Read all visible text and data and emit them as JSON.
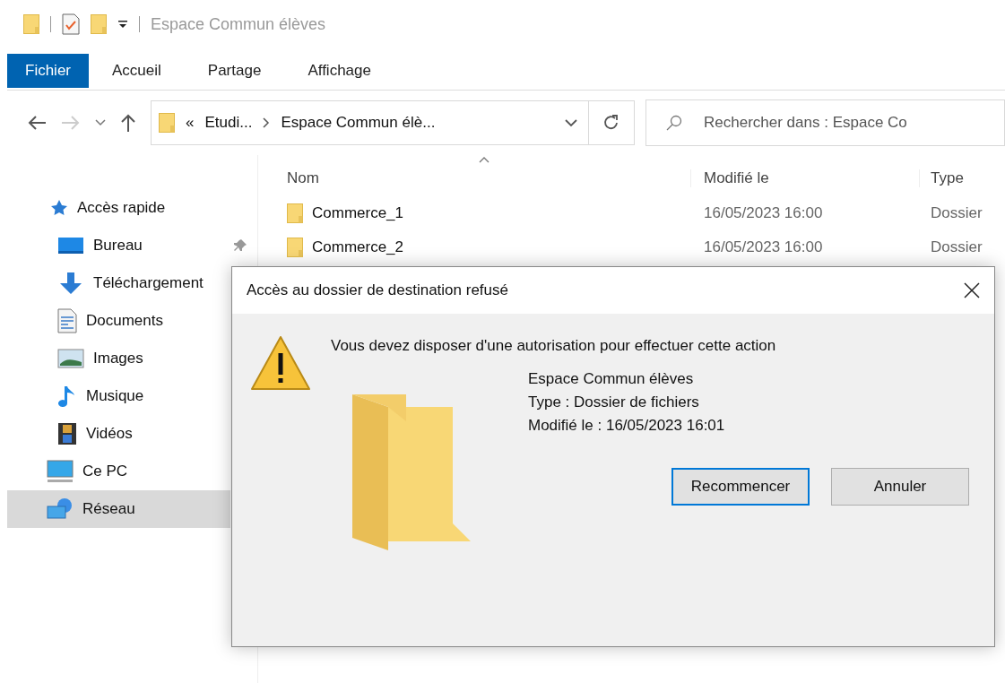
{
  "window": {
    "title": "Espace Commun élèves"
  },
  "ribbon_tabs": [
    {
      "label": "Fichier",
      "selected": true
    },
    {
      "label": "Accueil",
      "selected": false
    },
    {
      "label": "Partage",
      "selected": false
    },
    {
      "label": "Affichage",
      "selected": false
    }
  ],
  "address_bar": {
    "overflow": "«",
    "segments": [
      "Etudi...",
      "Espace Commun élè..."
    ]
  },
  "search": {
    "placeholder": "Rechercher dans : Espace Co"
  },
  "columns": [
    "Nom",
    "Modifié le",
    "Type"
  ],
  "rows": [
    {
      "name": "Commerce_1",
      "modified": "16/05/2023 16:00",
      "type": "Dossier"
    },
    {
      "name": "Commerce_2",
      "modified": "16/05/2023 16:00",
      "type": "Dossier"
    }
  ],
  "sidebar": {
    "items": [
      {
        "label": "Accès rapide",
        "kind": "star",
        "selected": false,
        "children": [
          {
            "label": "Bureau",
            "kind": "desktop",
            "selected": false,
            "pinned": true
          },
          {
            "label": "Téléchargement",
            "kind": "download",
            "selected": false
          },
          {
            "label": "Documents",
            "kind": "document",
            "selected": false
          },
          {
            "label": "Images",
            "kind": "image",
            "selected": false
          },
          {
            "label": "Musique",
            "kind": "music",
            "selected": false
          },
          {
            "label": "Vidéos",
            "kind": "video",
            "selected": false
          }
        ]
      },
      {
        "label": "Ce PC",
        "kind": "pc",
        "selected": false
      },
      {
        "label": "Réseau",
        "kind": "network",
        "selected": true
      }
    ]
  },
  "dialog": {
    "title": "Accès au dossier de destination refusé",
    "message": "Vous devez disposer d'une autorisation pour effectuer cette action",
    "details": [
      "Espace Commun élèves",
      "Type : Dossier de fichiers",
      "Modifié le : 16/05/2023 16:01"
    ],
    "buttons": [
      {
        "label": "Recommencer",
        "focused": true
      },
      {
        "label": "Annuler",
        "focused": false
      }
    ]
  }
}
